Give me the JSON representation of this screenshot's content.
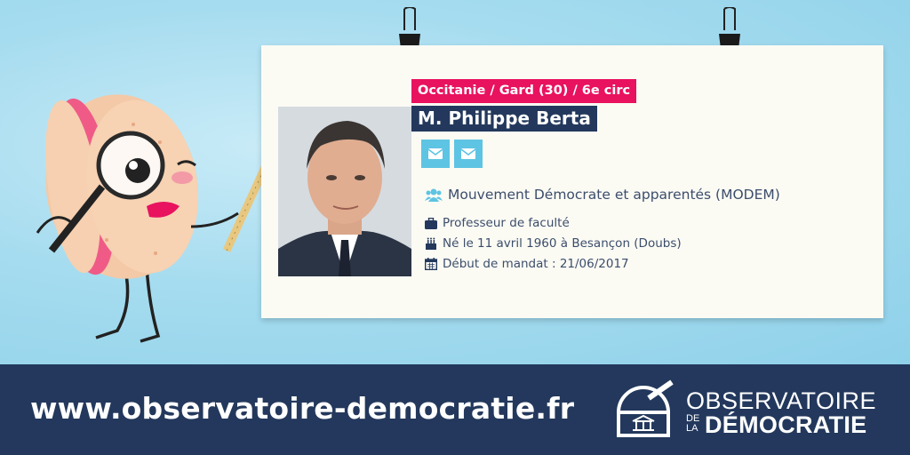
{
  "card": {
    "region": "Occitanie / Gard (30) / 6e circ",
    "name": "M. Philippe Berta",
    "group": "Mouvement Démocrate et apparentés (MODEM)",
    "profession": "Professeur de faculté",
    "birth": "Né le 11 avril 1960 à Besançon (Doubs)",
    "mandate_start": "Début de mandat : 21/06/2017",
    "contact_icons": [
      "envelope-icon",
      "envelope-icon"
    ]
  },
  "footer": {
    "url": "www.observatoire-democratie.fr",
    "logo_line1": "OBSERVATOIRE",
    "logo_de": "DE",
    "logo_la": "LA",
    "logo_line2": "DÉMOCRATIE"
  },
  "colors": {
    "region_bg": "#e8125f",
    "name_bg": "#23385c",
    "footer_bg": "#23385c",
    "icon_blue": "#5ec4e3",
    "sky": "#a6dcef"
  }
}
